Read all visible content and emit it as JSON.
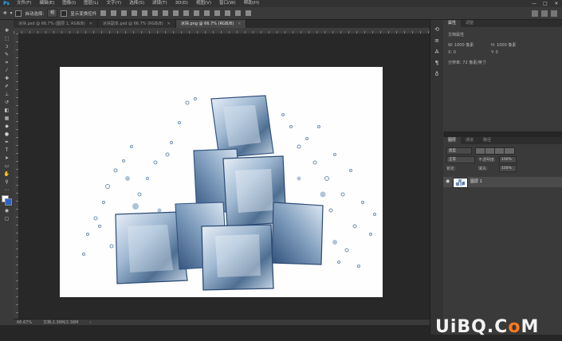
{
  "app": {
    "logo": "Ps",
    "window_controls": [
      "—",
      "□",
      "✕"
    ]
  },
  "menu": [
    "文件(F)",
    "编辑(E)",
    "图像(I)",
    "图层(L)",
    "文字(Y)",
    "选择(S)",
    "滤镜(T)",
    "3D(D)",
    "视图(V)",
    "窗口(W)",
    "帮助(H)"
  ],
  "options": {
    "auto_select_label": "自动选择:",
    "auto_select_value": "组",
    "show_transform": "显示变换控件"
  },
  "tabs": [
    {
      "label": "冰块.psd @ 66.7% (图层 1, RGB/8)",
      "active": false
    },
    {
      "label": "冰块副本.psd @ 66.7% (RGB/8)",
      "active": false
    },
    {
      "label": "冰块.png @ 66.7% (RGB/8)",
      "active": true
    }
  ],
  "status": {
    "zoom": "66.67%",
    "doc": "文档:2.36M/2.36M"
  },
  "properties": {
    "tabs": [
      "属性",
      "调整"
    ],
    "section": "文档属性",
    "w_label": "W: 1000 像素",
    "h_label": "H: 1000 像素",
    "x_label": "X: 0",
    "y_label": "Y: 0",
    "resolution": "分辨率: 72 像素/英寸"
  },
  "layers": {
    "tabs": [
      "图层",
      "通道",
      "路径"
    ],
    "kind": "类型",
    "blend": "正常",
    "opacity_label": "不透明度:",
    "opacity": "100%",
    "lock_label": "锁定:",
    "fill_label": "填充:",
    "fill": "100%",
    "layer_name": "图层 1"
  },
  "watermark": {
    "prefix": "UiBQ.C",
    "o": "o",
    "suffix": "M"
  }
}
